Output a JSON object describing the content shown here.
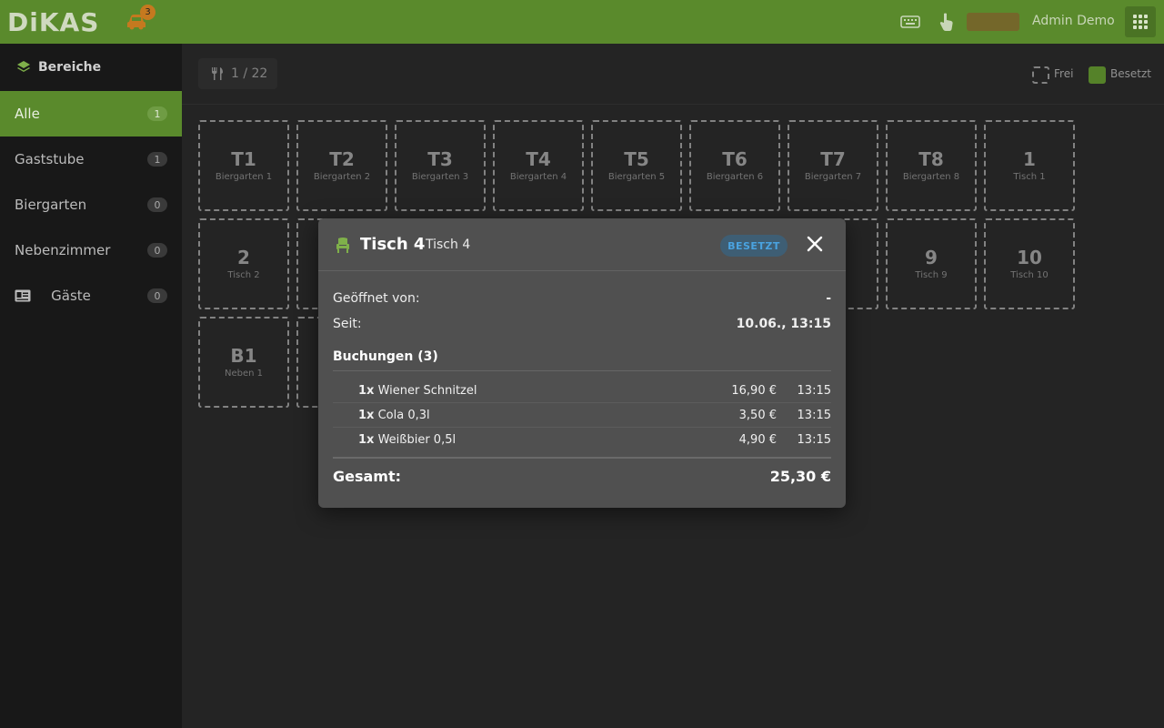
{
  "app": {
    "logo": "DiKAS",
    "car_badge": "3",
    "user": "Admin Demo"
  },
  "sidebar": {
    "header": "Bereiche",
    "items": [
      {
        "label": "Alle",
        "count": "1"
      },
      {
        "label": "Gaststube",
        "count": "1"
      },
      {
        "label": "Biergarten",
        "count": "0"
      },
      {
        "label": "Nebenzimmer",
        "count": "0"
      },
      {
        "label": "Gäste",
        "count": "0"
      }
    ]
  },
  "toolbar": {
    "page": "1 / 22",
    "legend_free": "Frei",
    "legend_occupied": "Besetzt"
  },
  "tables": [
    {
      "num": "T1",
      "sub": "Biergarten 1"
    },
    {
      "num": "T2",
      "sub": "Biergarten 2"
    },
    {
      "num": "T3",
      "sub": "Biergarten 3"
    },
    {
      "num": "T4",
      "sub": "Biergarten 4"
    },
    {
      "num": "T5",
      "sub": "Biergarten 5"
    },
    {
      "num": "T6",
      "sub": "Biergarten 6"
    },
    {
      "num": "T7",
      "sub": "Biergarten 7"
    },
    {
      "num": "T8",
      "sub": "Biergarten 8"
    },
    {
      "num": "1",
      "sub": "Tisch 1"
    },
    {
      "num": "2",
      "sub": "Tisch 2"
    },
    {
      "num": "9",
      "sub": "Tisch 9"
    },
    {
      "num": "10",
      "sub": "Tisch 10"
    },
    {
      "num": "B1",
      "sub": "Neben 1"
    }
  ],
  "colors": {
    "accent": "#5a8a2c",
    "badge_blue": "#4aa3e0",
    "modal_bg": "#505050"
  },
  "modal": {
    "title": "Tisch 4",
    "subtitle": "Tisch 4",
    "status": "BESETZT",
    "opened_by_label": "Geöffnet von:",
    "opened_by_value": "-",
    "since_label": "Seit:",
    "since_value": "10.06., 13:15",
    "bookings_header": "Buchungen (3)",
    "bookings": [
      {
        "qty": "1x",
        "name": "Wiener Schnitzel",
        "price": "16,90 €",
        "time": "13:15"
      },
      {
        "qty": "1x",
        "name": "Cola 0,3l",
        "price": "3,50 €",
        "time": "13:15"
      },
      {
        "qty": "1x",
        "name": "Weißbier 0,5l",
        "price": "4,90 €",
        "time": "13:15"
      }
    ],
    "total_label": "Gesamt:",
    "total_value": "25,30 €"
  }
}
